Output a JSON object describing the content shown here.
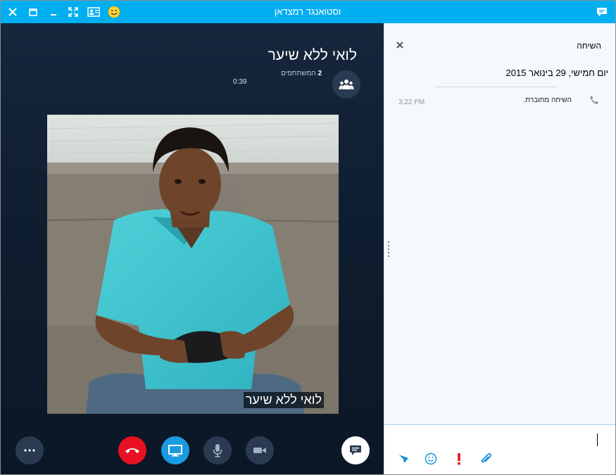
{
  "titlebar": {
    "title": "וסטואנגד רמצדאן"
  },
  "call": {
    "caller_name": "לואי      ללא שיער",
    "participants_count": "2",
    "participants_label": "המשתתפים",
    "duration": "0:39",
    "video_label": "לואי ללא שיער"
  },
  "conversation": {
    "title": "השיחה",
    "date": "יום חמישי, 29 בינואר 2015",
    "event_text": "השיחה מחוברת.",
    "event_time": "3:22 PM"
  },
  "colors": {
    "titlebar": "#00aff0",
    "call_background": "#0f1d30",
    "hangup": "#e81123",
    "screen_share": "#1a9be0",
    "accent": "#00aff0",
    "urgent": "#e81123"
  },
  "icons": {
    "titlebar": [
      "close-icon",
      "restore-icon",
      "minimize-icon",
      "fullscreen-icon",
      "contact-card-icon",
      "smiley-icon",
      "chat-bubble-icon"
    ],
    "call_controls": [
      "more-icon",
      "hangup-icon",
      "screen-share-icon",
      "mic-icon",
      "video-camera-icon",
      "chat-icon"
    ],
    "compose": [
      "send-icon",
      "emoji-icon",
      "urgent-icon",
      "attach-icon"
    ]
  }
}
